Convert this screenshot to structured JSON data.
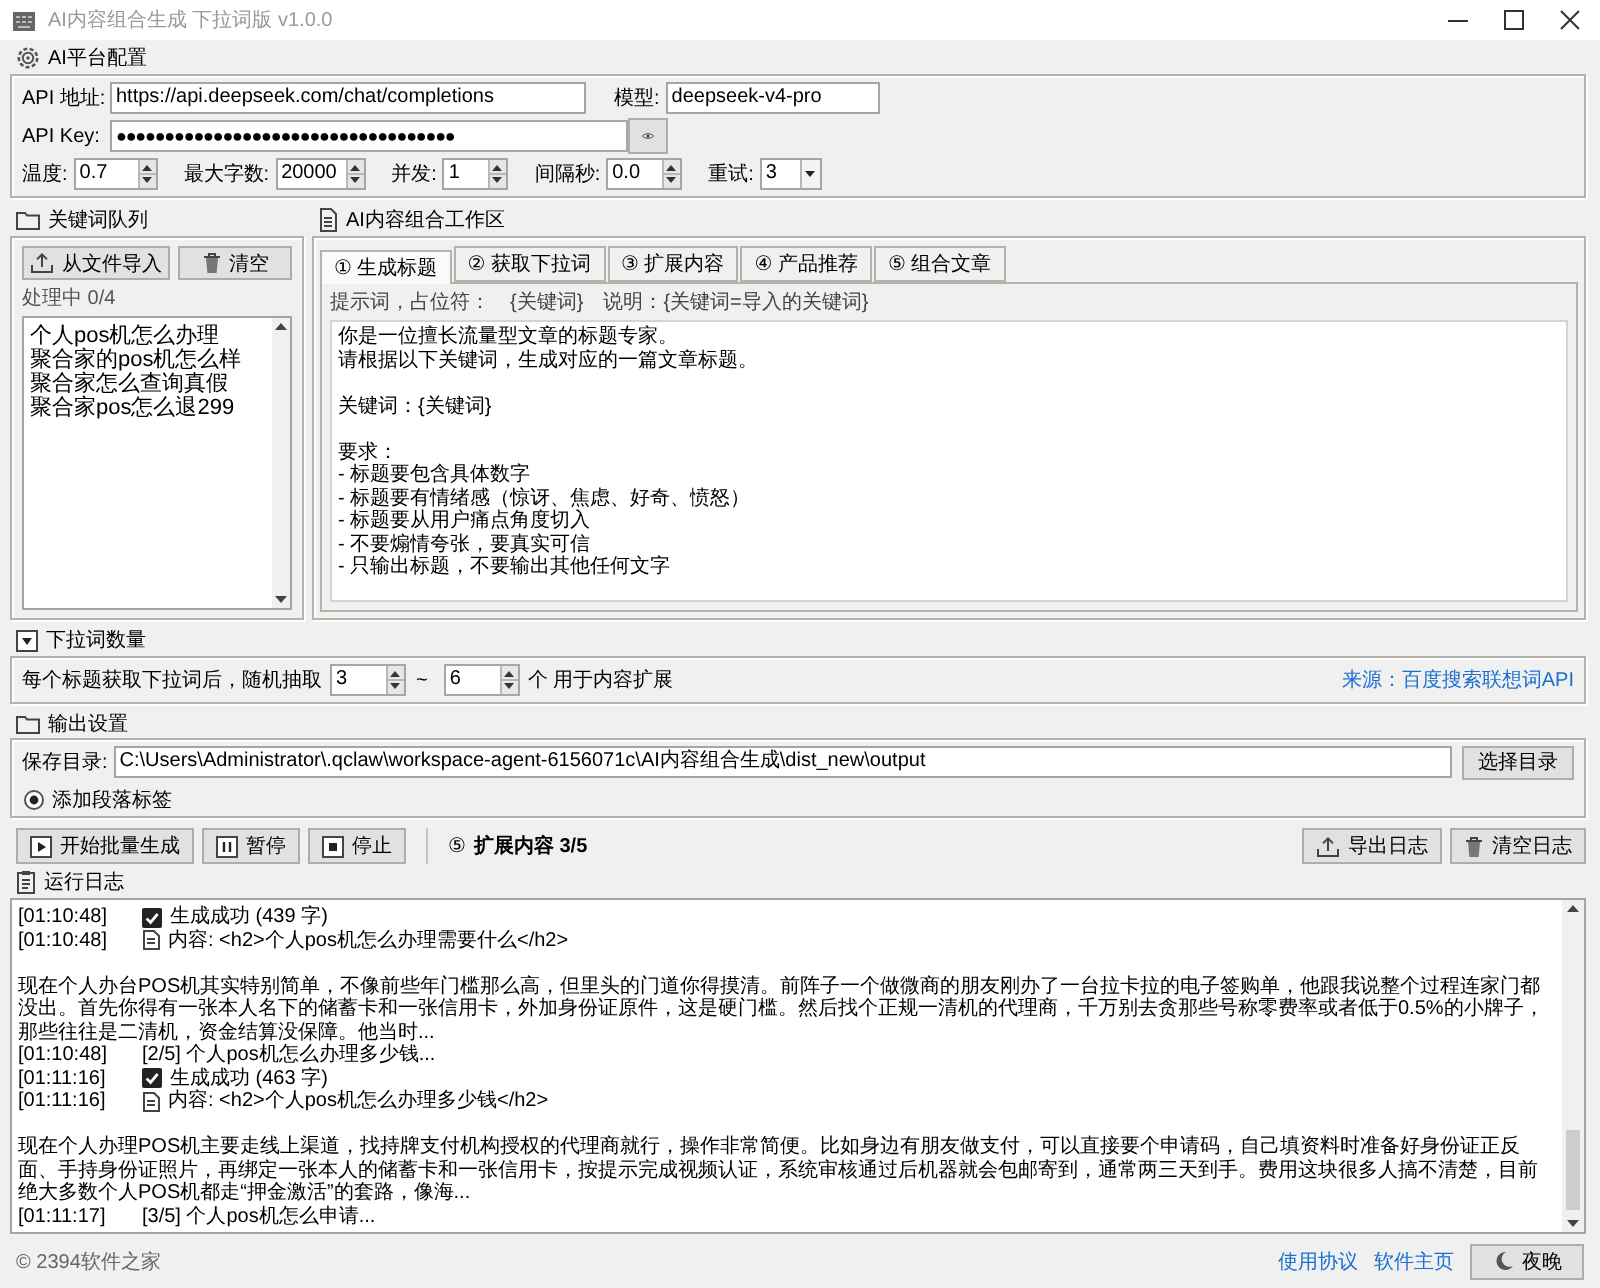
{
  "window": {
    "title": "AI内容组合生成 下拉词版 v1.0.0"
  },
  "platform_config": {
    "title": "AI平台配置",
    "api_url": {
      "label": "API 地址:",
      "value": "https://api.deepseek.com/chat/completions"
    },
    "model": {
      "label": "模型:",
      "value": "deepseek-v4-pro"
    },
    "api_key": {
      "label": "API Key:",
      "value": "●●●●●●●●●●●●●●●●●●●●●●●●●●●●●●●●●●●"
    },
    "params": [
      {
        "label": "温度:",
        "value": "0.7",
        "kind": "spin"
      },
      {
        "label": "最大字数:",
        "value": "20000",
        "kind": "spin"
      },
      {
        "label": "并发:",
        "value": "1",
        "kind": "spin"
      },
      {
        "label": "间隔秒:",
        "value": "0.0",
        "kind": "spin"
      },
      {
        "label": "重试:",
        "value": "3",
        "kind": "combo"
      }
    ]
  },
  "keyword_queue": {
    "title": "关键词队列",
    "buttons": [
      {
        "label": "从文件导入",
        "kind": "import"
      },
      {
        "label": "清空",
        "kind": "clear"
      }
    ],
    "status": "处理中 0/4",
    "items": [
      {
        "text": "个人pos机怎么办理",
        "selected": false
      },
      {
        "text": "聚合家的pos机怎么样",
        "selected": false
      },
      {
        "text": "聚合家怎么查询真假",
        "selected": false
      },
      {
        "text": "聚合家pos怎么退299",
        "selected": false
      }
    ]
  },
  "workspace": {
    "title": "AI内容组合工作区",
    "tabs": [
      {
        "label": "① 生成标题",
        "selected": true
      },
      {
        "label": "② 获取下拉词",
        "selected": false
      },
      {
        "label": "③ 扩展内容",
        "selected": false
      },
      {
        "label": "④ 产品推荐",
        "selected": false
      },
      {
        "label": "⑤ 组合文章",
        "selected": false
      }
    ],
    "hint": "提示词，占位符：",
    "placeholder_token": "{关键词}",
    "note": "说明：{关键词=导入的关键词}",
    "prompt": [
      [
        "你是一位擅长流量型文章的标题专家。",
        "请根据以下关键词，生成对应的一篇文章标题。"
      ],
      [
        "关键词：{关键词}"
      ],
      [
        "要求：",
        "- 标题要包含具体数字",
        "- 标题要有情绪感（惊讶、焦虑、好奇、愤怒）",
        "- 标题要从用户痛点角度切入",
        "- 不要煽情夸张，要真实可信",
        "- 只输出标题，不要输出其他任何文字"
      ]
    ]
  },
  "dropdown_count": {
    "title": "下拉词数量",
    "text_before": "每个标题获取下拉词后，随机抽取",
    "min": "3",
    "separator": "~",
    "max": "6",
    "text_after": "个 用于内容扩展",
    "source": "来源：百度搜索联想词API"
  },
  "output_settings": {
    "title": "输出设置",
    "save_dir": {
      "label": "保存目录:",
      "value": "C:\\Users\\Administrator\\.qclaw\\workspace-agent-6156071c\\AI内容组合生成\\dist_new\\output"
    },
    "browse_button": "选择目录",
    "paragraph_tags": {
      "label": "添加段落标签",
      "checked": true
    }
  },
  "toolbar": {
    "buttons": [
      {
        "label": "开始批量生成",
        "kind": "start"
      },
      {
        "label": "暂停",
        "kind": "pause"
      },
      {
        "label": "停止",
        "kind": "stop"
      }
    ],
    "step": "⑤",
    "status": "扩展内容 3/5",
    "log_buttons": [
      {
        "label": "导出日志",
        "kind": "export"
      },
      {
        "label": "清空日志",
        "kind": "clear"
      }
    ]
  },
  "log": {
    "title": "运行日志",
    "entries": [
      {
        "kind": "success",
        "time": "[01:10:48]",
        "text": "生成成功 (439 字)"
      },
      {
        "kind": "content",
        "time": "[01:10:48]",
        "text": "内容: <h2>个人pos机怎么办理需要什么</h2>"
      },
      {
        "kind": "paragraph",
        "text": "现在个人办台POS机其实特别简单，不像前些年门槛那么高，但里头的门道你得摸清。前阵子一个做微商的朋友刚办了一台拉卡拉的电子签购单，他跟我说整个过程连家门都没出。首先你得有一张本人名下的储蓄卡和一张信用卡，外加身份证原件，这是硬门槛。然后找个正规一清机的代理商，千万别去贪那些号称零费率或者低于0.5%的小牌子，那些往往是二清机，资金结算没保障。他当时..."
      },
      {
        "kind": "progress",
        "time": "[01:10:48]",
        "text": "[2/5] 个人pos机怎么办理多少钱..."
      },
      {
        "kind": "success",
        "time": "[01:11:16]",
        "text": "生成成功 (463 字)"
      },
      {
        "kind": "content",
        "time": "[01:11:16]",
        "text": "内容: <h2>个人pos机怎么办理多少钱</h2>"
      },
      {
        "kind": "paragraph",
        "text": "现在个人办理POS机主要走线上渠道，找持牌支付机构授权的代理商就行，操作非常简便。比如身边有朋友做支付，可以直接要个申请码，自己填资料时准备好身份证正反面、手持身份证照片，再绑定一张本人的储蓄卡和一张信用卡，按提示完成视频认证，系统审核通过后机器就会包邮寄到，通常两三天到手。费用这块很多人搞不清楚，目前绝大多数个人POS机都走“押金激活”的套路，像海..."
      },
      {
        "kind": "progress",
        "time": "[01:11:17]",
        "text": "[3/5] 个人pos机怎么申请..."
      }
    ]
  },
  "footer": {
    "copyright": "© 2394软件之家",
    "links": [
      "使用协议",
      "软件主页"
    ],
    "theme_button": "夜晚"
  }
}
